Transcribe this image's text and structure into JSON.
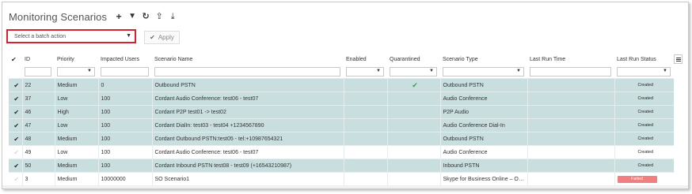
{
  "header": {
    "title": "Monitoring Scenarios",
    "toolbar": [
      {
        "name": "add-icon",
        "glyph": "+"
      },
      {
        "name": "filter-icon",
        "glyph": "▼"
      },
      {
        "name": "refresh-icon",
        "glyph": "↻"
      },
      {
        "name": "upload-icon",
        "glyph": "⇪"
      },
      {
        "name": "download-icon",
        "glyph": "⤓"
      }
    ]
  },
  "batch": {
    "placeholder": "Select a batch action",
    "apply_label": "Apply"
  },
  "table": {
    "columns": [
      "ID",
      "Priority",
      "Impacted Users",
      "Scenario Name",
      "Enabled",
      "Quarantined",
      "Scenario Type",
      "Last Run Time",
      "Last Run Status"
    ],
    "rows": [
      {
        "selected": true,
        "id": "22",
        "priority": "Medium",
        "users": "0",
        "name": "Outbound PSTN",
        "quarantined": true,
        "type": "Outbound PSTN",
        "last_run": "",
        "status": "Created"
      },
      {
        "selected": true,
        "id": "37",
        "priority": "Low",
        "users": "100",
        "name": "Cordant Audio Conference: test06 - test07",
        "quarantined": false,
        "type": "Audio Conference",
        "last_run": "",
        "status": "Created"
      },
      {
        "selected": true,
        "id": "46",
        "priority": "High",
        "users": "100",
        "name": "Cordant P2P test01 -> test02",
        "quarantined": false,
        "type": "P2P Audio",
        "last_run": "",
        "status": "Created"
      },
      {
        "selected": true,
        "id": "47",
        "priority": "Low",
        "users": "100",
        "name": "Cordant DialIn: test03 - test04 +1234567890",
        "quarantined": false,
        "type": "Audio Conference Dial-In",
        "last_run": "",
        "status": "Created"
      },
      {
        "selected": true,
        "id": "48",
        "priority": "Medium",
        "users": "100",
        "name": "Cordant Outbound PSTN:test05 - tel:+10987654321",
        "quarantined": false,
        "type": "Outbound PSTN",
        "last_run": "",
        "status": "Created"
      },
      {
        "selected": false,
        "id": "49",
        "priority": "Low",
        "users": "100",
        "name": "Cordant Audio Conference: test06 - test07",
        "quarantined": false,
        "type": "Audio Conference",
        "last_run": "",
        "status": "Created"
      },
      {
        "selected": true,
        "id": "50",
        "priority": "Medium",
        "users": "100",
        "name": "Cordant Inbound PSTN test08 - test09 (+16543210987)",
        "quarantined": false,
        "type": "Inbound PSTN",
        "last_run": "",
        "status": "Created"
      },
      {
        "selected": false,
        "id": "3",
        "priority": "Medium",
        "users": "10000000",
        "name": "SO Scenario1",
        "quarantined": false,
        "type": "Skype for Business Online – Out...",
        "last_run": "",
        "status": "Failed"
      }
    ]
  },
  "colors": {
    "selected_row": "#c9dfdf",
    "failed": "#f07f7f",
    "quarantined_check": "#2ea44f",
    "batch_border": "#d4232e"
  }
}
